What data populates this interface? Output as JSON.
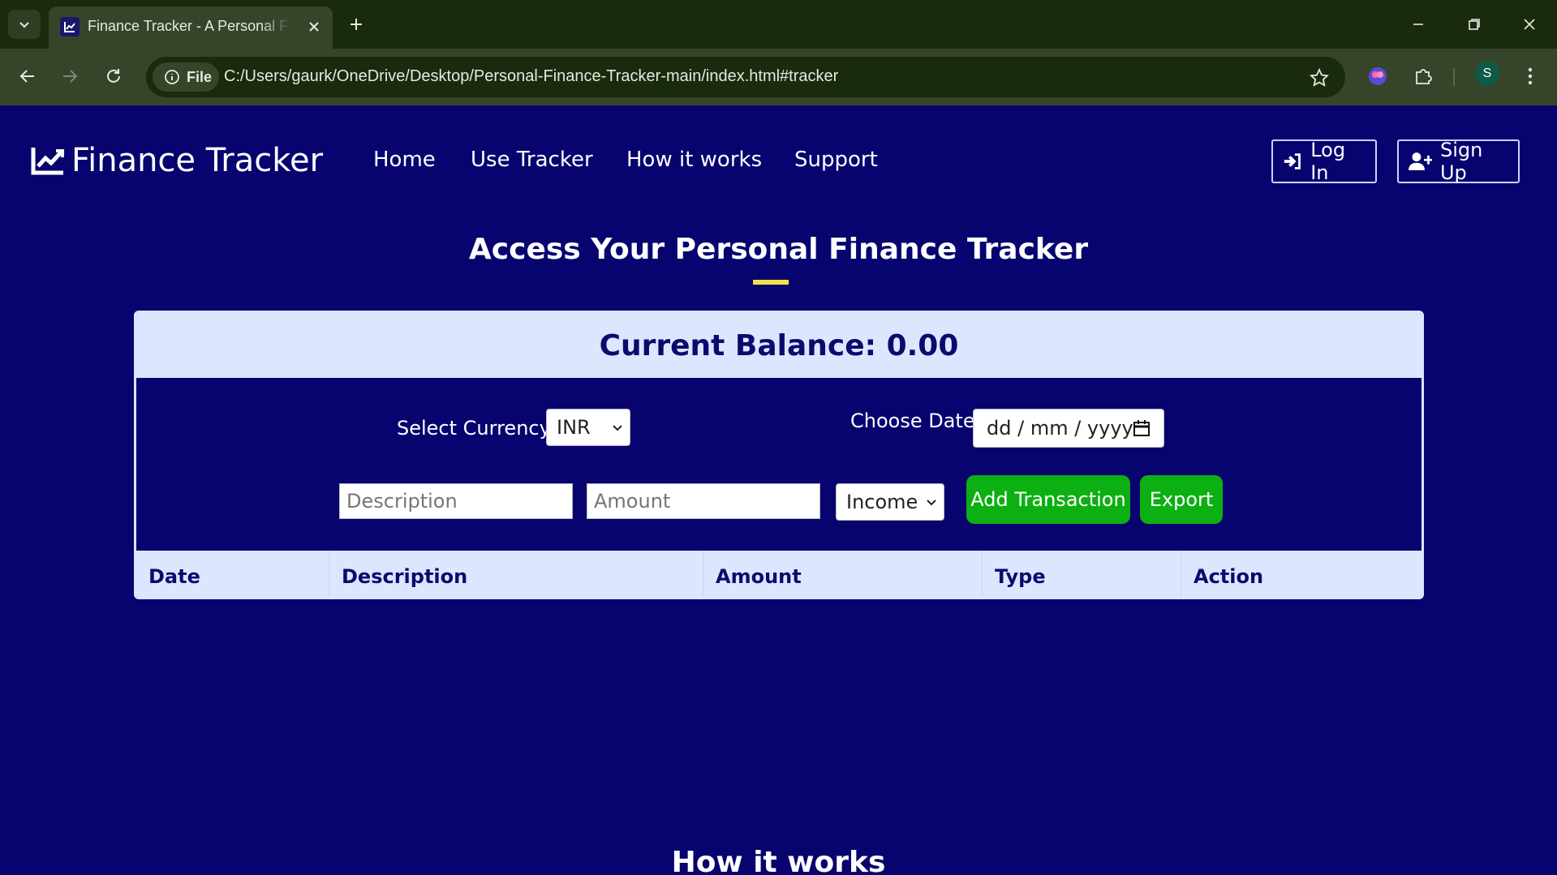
{
  "browser": {
    "tab_title": "Finance Tracker - A Personal Finance Tracker",
    "chip_label": "File",
    "url": "C:/Users/gaurk/OneDrive/Desktop/Personal-Finance-Tracker-main/index.html#tracker",
    "profile_initial": "S"
  },
  "site": {
    "logo_text": "Finance Tracker",
    "nav": [
      "Home",
      "Use Tracker",
      "How it works",
      "Support"
    ],
    "login_label": "Log In",
    "signup_label": "Sign Up"
  },
  "tracker": {
    "section_title": "Access Your Personal Finance Tracker",
    "balance_text": "Current Balance: 0.00",
    "currency_label": "Select Currency:",
    "currency_value": "INR",
    "date_label": "Choose Date:",
    "date_placeholder": "dd / mm / yyyy",
    "description_placeholder": "Description",
    "amount_placeholder": "Amount",
    "type_value": "Income",
    "add_button": "Add Transaction",
    "export_button": "Export",
    "columns": [
      "Date",
      "Description",
      "Amount",
      "Type",
      "Action"
    ]
  },
  "next_section_title": "How it works",
  "colors": {
    "page_bg": "#07036f",
    "panel_bg": "#dbe7ff",
    "accent_green": "#0db012",
    "underline": "#f3e34a"
  }
}
